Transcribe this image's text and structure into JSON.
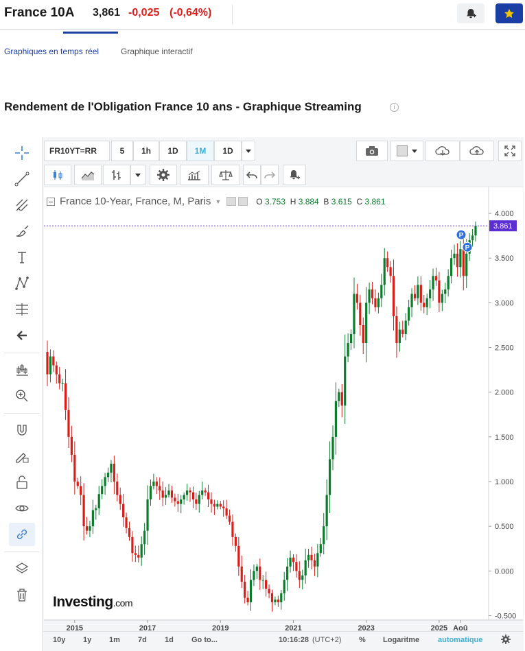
{
  "header": {
    "title": "France 10A",
    "price": "3,861",
    "change": "-0,025",
    "change_pct": "(-0,64%)"
  },
  "tabs": [
    {
      "label": "Graphiques en temps réel"
    },
    {
      "label": "Graphique interactif"
    }
  ],
  "section_title": "Rendement de l'Obligation France 10 ans - Graphique Streaming",
  "toolbar": {
    "symbol": "FR10YT=RR",
    "intervals": [
      "5",
      "1h",
      "1D",
      "1M",
      "1D"
    ],
    "active_interval": "1M"
  },
  "legend": {
    "name": "France 10-Year, France, M, Paris",
    "o_label": "O",
    "o": "3.753",
    "h_label": "H",
    "h": "3.884",
    "b_label": "B",
    "b": "3.615",
    "c_label": "C",
    "c": "3.861"
  },
  "chart_data": {
    "type": "candlestick",
    "x_ticks": [
      "2015",
      "2017",
      "2019",
      "2021",
      "2023",
      "2025",
      "Aoû"
    ],
    "y_ticks": [
      "4.000",
      "3.500",
      "3.000",
      "2.500",
      "2.000",
      "1.500",
      "1.000",
      "0.500",
      "0.000",
      "-0.500"
    ],
    "ylim": [
      -0.55,
      4.3
    ],
    "x_start": "2014-04",
    "last_price": "3.861",
    "up_color": "#0a7d2b",
    "down_color": "#d91e18",
    "closes": [
      2.2,
      2.4,
      2.3,
      2.2,
      2.1,
      2.1,
      1.8,
      1.5,
      1.3,
      1.0,
      0.95,
      0.85,
      0.5,
      0.45,
      0.5,
      0.68,
      0.7,
      0.86,
      0.95,
      1.05,
      1.1,
      1.2,
      1.0,
      0.85,
      0.75,
      0.6,
      0.48,
      0.38,
      0.2,
      0.18,
      0.15,
      0.3,
      0.45,
      0.8,
      0.95,
      1.0,
      0.95,
      0.9,
      0.82,
      0.85,
      0.9,
      0.82,
      0.78,
      0.75,
      0.8,
      0.85,
      0.9,
      0.88,
      0.8,
      0.75,
      0.85,
      0.9,
      0.88,
      0.8,
      0.75,
      0.72,
      0.75,
      0.72,
      0.7,
      0.62,
      0.55,
      0.38,
      0.28,
      0.05,
      -0.12,
      -0.3,
      -0.35,
      -0.1,
      0.0,
      0.05,
      -0.1,
      -0.1,
      -0.2,
      -0.25,
      -0.35,
      -0.32,
      -0.35,
      -0.25,
      -0.1,
      0.05,
      0.15,
      0.1,
      0.0,
      -0.1,
      -0.05,
      0.12,
      0.18,
      0.12,
      0.05,
      0.2,
      0.3,
      0.5,
      0.85,
      1.25,
      1.5,
      1.9,
      2.0,
      1.85,
      2.4,
      2.55,
      2.65,
      3.1,
      3.0,
      2.75,
      2.55,
      3.0,
      3.15,
      3.05,
      2.95,
      3.05,
      3.2,
      3.5,
      3.4,
      3.3,
      2.85,
      2.55,
      2.7,
      2.65,
      2.8,
      2.95,
      3.1,
      3.05,
      3.2,
      3.0,
      2.95,
      3.05,
      3.15,
      3.3,
      3.25,
      3.0,
      3.1,
      3.15,
      3.3,
      3.5,
      3.55,
      3.4,
      3.6,
      3.3,
      3.55,
      3.7,
      3.753,
      3.861
    ]
  },
  "bottom_bar": {
    "ranges": [
      "10y",
      "1y",
      "1m",
      "7d",
      "1d"
    ],
    "goto": "Go to...",
    "time": "10:16:28",
    "tz": "(UTC+2)",
    "pct": "%",
    "log": "Logaritme",
    "auto": "automatique"
  },
  "logo": {
    "main": "Investing",
    "suffix": ".com"
  },
  "colors": {
    "accent": "#1a3ea3",
    "up": "#0a7d2b",
    "down": "#d91e18",
    "price_label": "#5b2fd1",
    "toolbar_active": "#3db1d6"
  }
}
